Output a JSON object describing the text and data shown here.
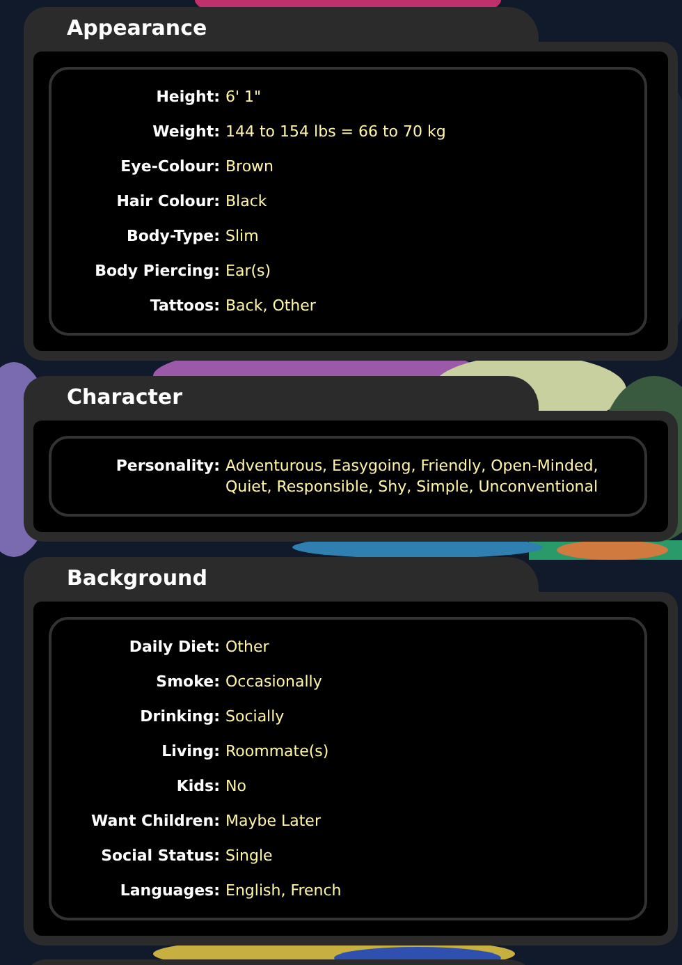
{
  "sections": [
    {
      "title": "Appearance",
      "rows": [
        {
          "label": "Height:",
          "value": "6' 1\""
        },
        {
          "label": "Weight:",
          "value": "144 to 154 lbs = 66 to 70 kg"
        },
        {
          "label": "Eye-Colour:",
          "value": "Brown"
        },
        {
          "label": "Hair Colour:",
          "value": "Black"
        },
        {
          "label": "Body-Type:",
          "value": "Slim"
        },
        {
          "label": "Body Piercing:",
          "value": "Ear(s)"
        },
        {
          "label": "Tattoos:",
          "value": "Back, Other"
        }
      ]
    },
    {
      "title": "Character",
      "rows": [
        {
          "label": "Personality:",
          "value": "Adventurous, Easygoing, Friendly, Open-Minded, Quiet, Responsible, Shy, Simple, Unconventional"
        }
      ]
    },
    {
      "title": "Background",
      "rows": [
        {
          "label": "Daily Diet:",
          "value": "Other"
        },
        {
          "label": "Smoke:",
          "value": "Occasionally"
        },
        {
          "label": "Drinking:",
          "value": "Socially"
        },
        {
          "label": "Living:",
          "value": "Roommate(s)"
        },
        {
          "label": "Kids:",
          "value": "No"
        },
        {
          "label": "Want Children:",
          "value": "Maybe Later"
        },
        {
          "label": "Social Status:",
          "value": "Single"
        },
        {
          "label": "Languages:",
          "value": "English, French"
        }
      ]
    }
  ]
}
